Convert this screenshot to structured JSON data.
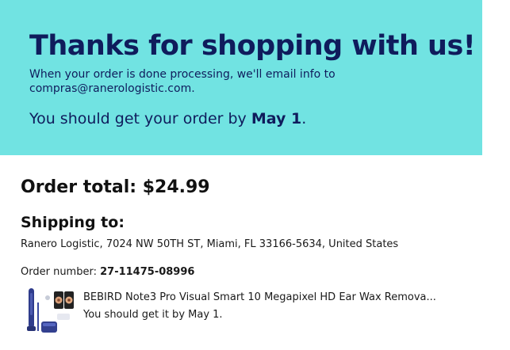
{
  "banner": {
    "title": "Thanks for shopping with us!",
    "message": "When your order is done processing, we'll email info to compras@ranerologistic.com.",
    "delivery_prefix": "You should get your order by ",
    "delivery_date": "May 1",
    "delivery_suffix": ".",
    "background_color": "#71e3e2",
    "text_color": "#0f1c5c"
  },
  "order": {
    "total_label": "Order total: $24.99",
    "shipping_heading": "Shipping to:",
    "address": "Ranero Logistic, 7024 NW 50TH ST, Miami, FL 33166-5634, United States",
    "number_label": "Order number: ",
    "number_value": "27-11475-08996"
  },
  "item": {
    "title": "BEBIRD Note3 Pro Visual Smart 10 Megapixel HD Ear Wax Remova...",
    "delivery": "You should get it by May 1.",
    "thumbnail_icon": "ear-wax-remover-product-image"
  }
}
